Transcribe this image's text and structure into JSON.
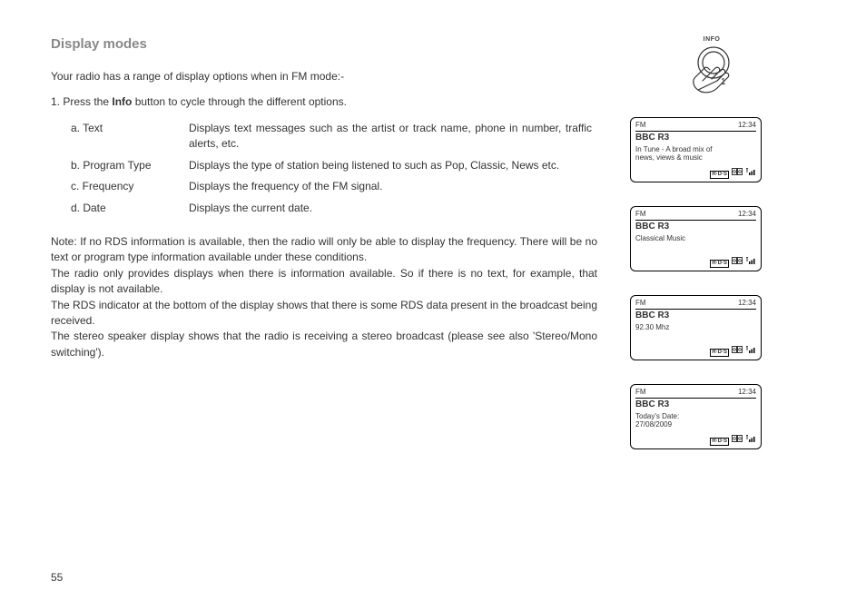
{
  "page_number": "55",
  "title": "Display modes",
  "intro": "Your radio has a range of display options when in FM mode:-",
  "step_prefix": "1. Press the ",
  "step_bold": "Info",
  "step_suffix": " button to cycle through the different options.",
  "info_button_label": "INFO",
  "options": [
    {
      "label": "a. Text",
      "desc": "Displays text messages such as the artist or track name, phone in number, traffic alerts, etc."
    },
    {
      "label": "b. Program Type",
      "desc": "Displays the type of station being listened to such as Pop, Classic, News etc."
    },
    {
      "label": "c. Frequency",
      "desc": "Displays the frequency of the FM signal."
    },
    {
      "label": "d. Date",
      "desc": "Displays the current date."
    }
  ],
  "note": "Note: If no RDS information is available, then the radio will only be able to display the frequency. There will be no text or program type information available under these conditions.\nThe radio only provides displays when there is information available. So if there is no text, for example, that display is not available.\nThe RDS indicator at the bottom of the display shows that there is some RDS data present in the broadcast being received.\nThe stereo speaker display shows that the radio is receiving a stereo broadcast (please see also 'Stereo/Mono switching').",
  "lcd_common": {
    "mode": "FM",
    "time": "12:34",
    "station": "BBC R3",
    "rds_indicator": "R·D·S",
    "stereo_indicator": "⧉",
    "signal_icon": "▮▮"
  },
  "screens": [
    {
      "line1": "In Tune - A broad mix of",
      "line2": "news, views & music"
    },
    {
      "line1": "Classical Music",
      "line2": ""
    },
    {
      "line1": "92.30 Mhz",
      "line2": ""
    },
    {
      "line1": "Today's Date:",
      "line2": "27/08/2009"
    }
  ]
}
